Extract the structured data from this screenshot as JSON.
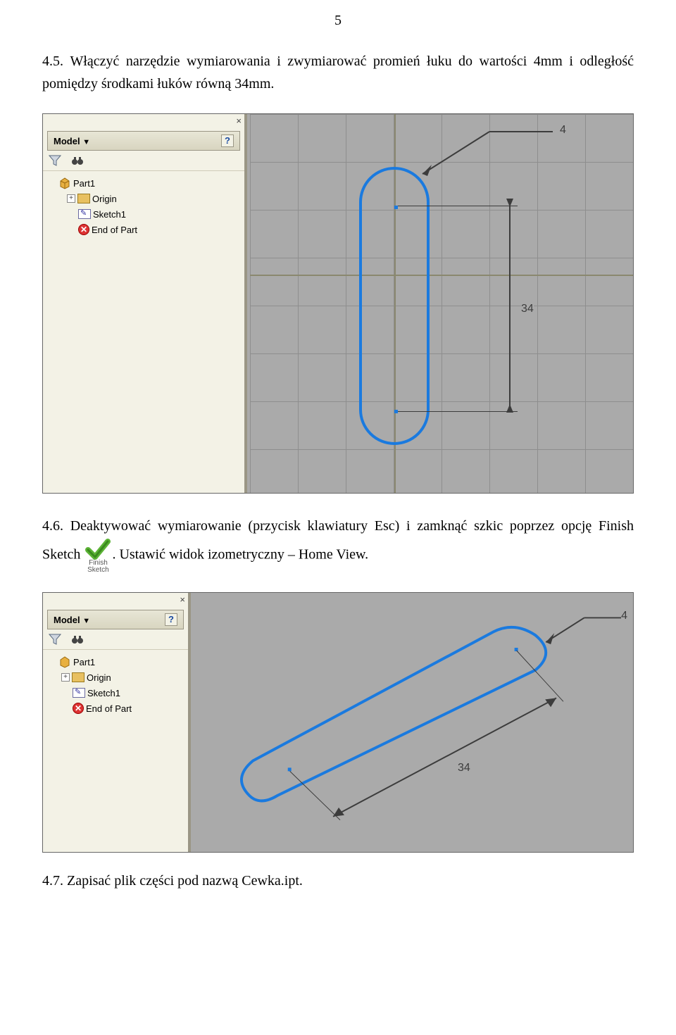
{
  "page_number": "5",
  "para_4_5": "4.5. Włączyć narzędzie wymiarowania i zwymiarować promień łuku do wartości 4mm i odległość pomiędzy środkami łuków równą 34mm.",
  "para_4_6_prefix": "4.6. Deaktywować wymiarowanie (przycisk klawiatury Esc) i zamknąć szkic poprzez opcję Finish Sketch ",
  "para_4_6_suffix": ". Ustawić widok izometryczny – Home View.",
  "para_4_7": "4.7. Zapisać plik części pod nazwą Cewka.ipt.",
  "panel": {
    "model_label": "Model",
    "part_label": "Part1",
    "origin_label": "Origin",
    "sketch_label": "Sketch1",
    "endpart_label": "End of Part"
  },
  "dims": {
    "radius": "4",
    "length": "34"
  },
  "finish": {
    "line1": "Finish",
    "line2": "Sketch"
  }
}
